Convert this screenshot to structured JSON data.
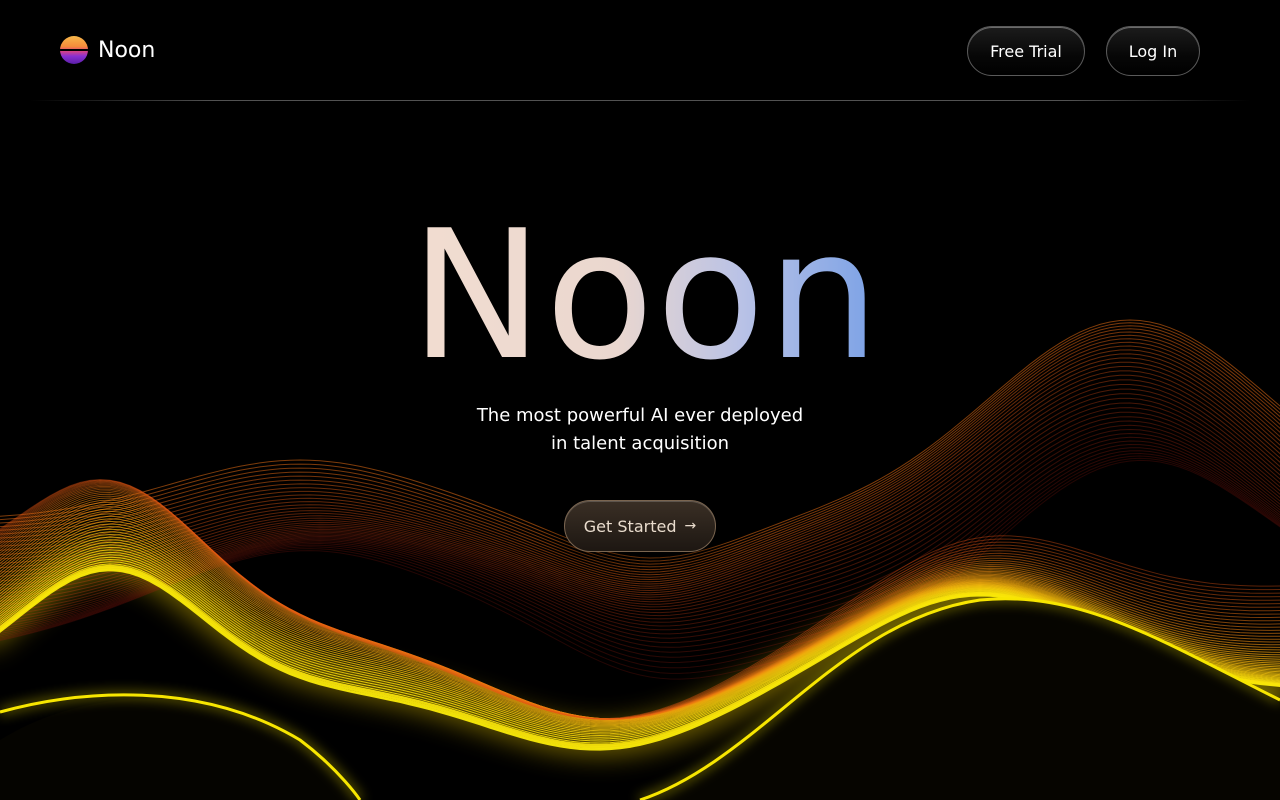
{
  "brand": {
    "name": "Noon",
    "logo_icon": "sunset-sphere-icon"
  },
  "nav": {
    "free_trial_label": "Free Trial",
    "login_label": "Log In"
  },
  "hero": {
    "title": "Noon",
    "subtitle_line1": "The most powerful AI ever deployed",
    "subtitle_line2": "in talent acquisition",
    "cta_label": "Get Started",
    "cta_icon": "arrow-right-icon",
    "cta_arrow_glyph": "→"
  },
  "colors": {
    "background": "#000000",
    "wave_yellow": "#f5e800",
    "wave_orange": "#e87a10",
    "wave_red": "#c0401a",
    "title_gradient_start": "#f2ddd0",
    "title_gradient_end": "#7ea3e6"
  }
}
